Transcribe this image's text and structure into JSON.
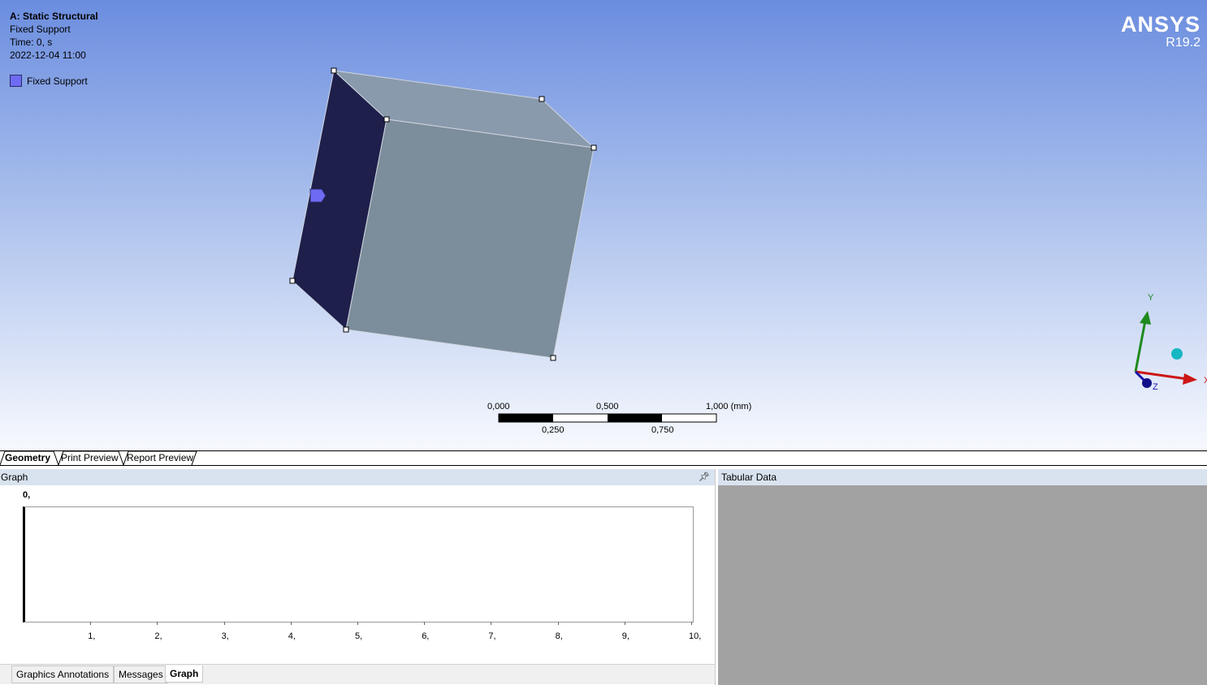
{
  "info": {
    "title": "A: Static Structural",
    "object": "Fixed Support",
    "time": "Time: 0, s",
    "date": "2022-12-04 11:00"
  },
  "legend": {
    "label": "Fixed Support",
    "color": "#6e6bf2"
  },
  "brand": {
    "name": "ANSYS",
    "version": "R19.2"
  },
  "scale_bar": {
    "top_labels": [
      "0,000",
      "0,500",
      "1,000 (mm)"
    ],
    "bottom_labels": [
      "0,250",
      "0,750"
    ]
  },
  "axes_triad": {
    "y": "Y",
    "z": "Z",
    "x": "X"
  },
  "view_tabs": [
    {
      "label": "Geometry",
      "active": true
    },
    {
      "label": "Print Preview",
      "active": false
    },
    {
      "label": "Report Preview",
      "active": false
    }
  ],
  "graph": {
    "title": "Graph",
    "pin_icon": "pin-icon",
    "y_max": "0,",
    "x_ticks": [
      "1,",
      "2,",
      "3,",
      "4,",
      "5,",
      "6,",
      "7,",
      "8,",
      "9,",
      "10,"
    ]
  },
  "tabular": {
    "title": "Tabular Data"
  },
  "bottom_tabs": [
    {
      "label": "Graphics Annotations",
      "active": false
    },
    {
      "label": "Messages",
      "active": false
    },
    {
      "label": "Graph",
      "active": true
    }
  ],
  "colors": {
    "face_front": "#7c8d9b",
    "face_left": "#1f1f4b",
    "face_top": "#8a9aad",
    "viewport_top": "#6b8ddf"
  }
}
